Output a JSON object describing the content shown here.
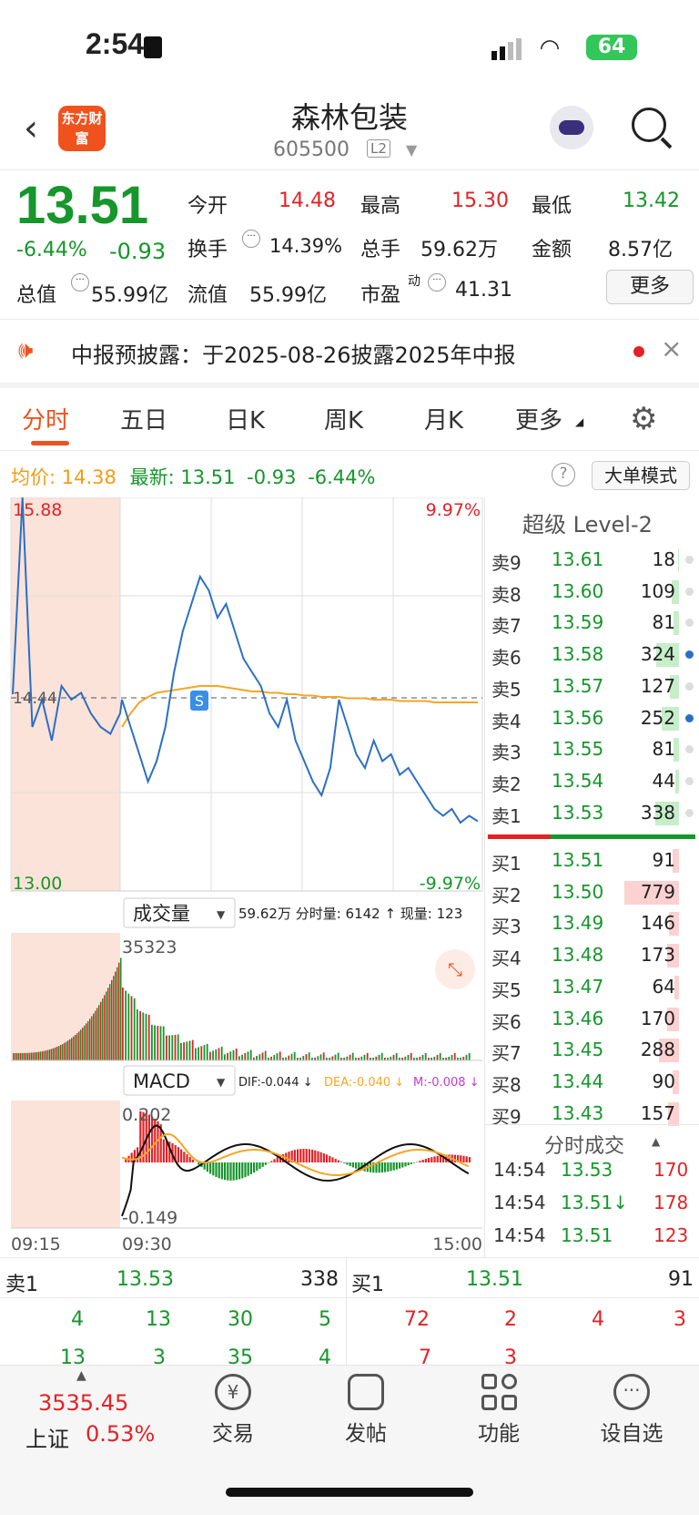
{
  "status_bar": {
    "time": "2:54",
    "battery": "64"
  },
  "header": {
    "stock_name": "森林包装",
    "stock_code": "605500",
    "level_badge": "L2",
    "logo_text": "东方财富"
  },
  "quote": {
    "price": "13.51",
    "change_pct": "-6.44%",
    "change": "-0.93",
    "open_label": "今开",
    "open": "14.48",
    "high_label": "最高",
    "high": "15.30",
    "low_label": "最低",
    "low": "13.42",
    "turnover_label": "换手",
    "turnover": "14.39%",
    "volume_label": "总手",
    "volume": "59.62万",
    "amount_label": "金额",
    "amount": "8.57亿",
    "mktcap_label": "总值",
    "mktcap": "55.99亿",
    "float_label": "流值",
    "float_cap": "55.99亿",
    "pe_label": "市盈",
    "pe_sup": "动",
    "pe": "41.31",
    "more_button": "更多"
  },
  "notice": {
    "text": "中报预披露：于2025-08-26披露2025年中报"
  },
  "tabs": [
    "分时",
    "五日",
    "日K",
    "周K",
    "月K",
    "更多"
  ],
  "chart_header": {
    "avg_label": "均价:",
    "avg": "14.38",
    "latest_label": "最新:",
    "latest": "13.51",
    "change": "-0.93",
    "change_pct": "-6.44%",
    "bigorder_btn": "大单模式"
  },
  "chart_data": {
    "type": "line",
    "price_top": "15.88",
    "price_bottom": "13.00",
    "pct_top": "9.97%",
    "pct_bottom": "-9.97%",
    "prev_close_label": "14.44",
    "price_series": [
      14.44,
      15.88,
      14.2,
      14.4,
      14.1,
      14.5,
      14.4,
      14.45,
      14.3,
      14.2,
      14.15,
      14.3,
      14.4,
      14.2,
      14.0,
      13.8,
      13.95,
      14.2,
      14.6,
      14.9,
      15.1,
      15.3,
      15.2,
      15.0,
      15.1,
      14.9,
      14.7,
      14.6,
      14.5,
      14.3,
      14.2,
      14.4,
      14.1,
      13.95,
      13.8,
      13.7,
      13.9,
      14.4,
      14.2,
      14.0,
      13.9,
      14.1,
      13.95,
      14.0,
      13.85,
      13.9,
      13.8,
      13.7,
      13.6,
      13.55,
      13.6,
      13.5,
      13.55,
      13.51
    ],
    "avg_series": [
      14.44,
      14.44,
      14.44,
      14.44,
      14.44,
      14.44,
      14.44,
      14.44,
      14.44,
      14.44,
      14.44,
      14.44,
      14.2,
      14.3,
      14.38,
      14.42,
      14.45,
      14.46,
      14.47,
      14.48,
      14.49,
      14.5,
      14.5,
      14.5,
      14.49,
      14.48,
      14.47,
      14.46,
      14.46,
      14.45,
      14.45,
      14.44,
      14.44,
      14.43,
      14.43,
      14.42,
      14.42,
      14.42,
      14.41,
      14.41,
      14.41,
      14.4,
      14.4,
      14.4,
      14.39,
      14.39,
      14.39,
      14.39,
      14.38,
      14.38,
      14.38,
      14.38,
      14.38,
      14.38
    ],
    "volume_title": "成交量",
    "volume_info": "59.62万 分时量: 6142 ↑ 现量: 123",
    "volume_max": "35323",
    "macd_title": "MACD",
    "dif": "DIF:-0.044 ↓",
    "dea": "DEA:-0.040 ↓",
    "m": "M:-0.008 ↓",
    "macd_top": "0.202",
    "macd_bottom": "-0.149",
    "x_labels": [
      "09:15",
      "09:30",
      "15:00"
    ]
  },
  "order_book": {
    "title": "超级 Level-2",
    "asks": [
      {
        "label": "卖9",
        "price": "13.61",
        "vol": "18",
        "w": 0.02
      },
      {
        "label": "卖8",
        "price": "13.60",
        "vol": "109",
        "w": 0.14
      },
      {
        "label": "卖7",
        "price": "13.59",
        "vol": "81",
        "w": 0.1
      },
      {
        "label": "卖6",
        "price": "13.58",
        "vol": "324",
        "w": 0.42
      },
      {
        "label": "卖5",
        "price": "13.57",
        "vol": "127",
        "w": 0.16
      },
      {
        "label": "卖4",
        "price": "13.56",
        "vol": "252",
        "w": 0.32
      },
      {
        "label": "卖3",
        "price": "13.55",
        "vol": "81",
        "w": 0.1
      },
      {
        "label": "卖2",
        "price": "13.54",
        "vol": "44",
        "w": 0.06
      },
      {
        "label": "卖1",
        "price": "13.53",
        "vol": "338",
        "w": 0.43
      }
    ],
    "bids": [
      {
        "label": "买1",
        "price": "13.51",
        "vol": "91",
        "w": 0.12
      },
      {
        "label": "买2",
        "price": "13.50",
        "vol": "779",
        "w": 1.0
      },
      {
        "label": "买3",
        "price": "13.49",
        "vol": "146",
        "w": 0.19
      },
      {
        "label": "买4",
        "price": "13.48",
        "vol": "173",
        "w": 0.22
      },
      {
        "label": "买5",
        "price": "13.47",
        "vol": "64",
        "w": 0.08
      },
      {
        "label": "买6",
        "price": "13.46",
        "vol": "170",
        "w": 0.22
      },
      {
        "label": "买7",
        "price": "13.45",
        "vol": "288",
        "w": 0.37
      },
      {
        "label": "买8",
        "price": "13.44",
        "vol": "90",
        "w": 0.12
      },
      {
        "label": "买9",
        "price": "13.43",
        "vol": "157",
        "w": 0.2
      }
    ],
    "trades_title": "分时成交",
    "trades": [
      {
        "time": "14:54",
        "price": "13.53",
        "vol": "170"
      },
      {
        "time": "14:54",
        "price": "13.51↓",
        "vol": "178"
      },
      {
        "time": "14:54",
        "price": "13.51",
        "vol": "123"
      }
    ]
  },
  "queue": {
    "ask_label": "卖1",
    "ask_price": "13.53",
    "ask_vol": "338",
    "bid_label": "买1",
    "bid_price": "13.51",
    "bid_vol": "91",
    "ask_row1": [
      "4",
      "13",
      "30",
      "5"
    ],
    "ask_row2": [
      "13",
      "3",
      "35",
      "4"
    ],
    "bid_row1": [
      "72",
      "2",
      "4",
      "3"
    ],
    "bid_row2": [
      "7",
      "3"
    ]
  },
  "tabbar": {
    "index_value": "3535.45",
    "index_name": "上证",
    "index_pct": "0.53%",
    "items": [
      "交易",
      "发帖",
      "功能",
      "设自选"
    ]
  }
}
